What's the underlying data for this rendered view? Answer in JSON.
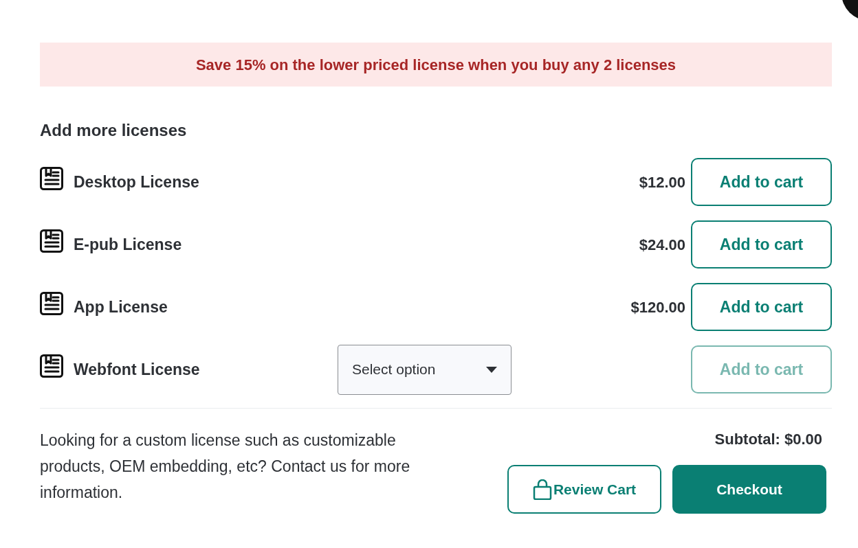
{
  "promo_banner": "Save 15% on the lower priced license when you buy any 2 licenses",
  "section_title": "Add more licenses",
  "licenses": [
    {
      "kind": "price",
      "name": "Desktop License",
      "price": "$12.00",
      "button": "Add to cart",
      "disabled": false
    },
    {
      "kind": "price",
      "name": "E-pub License",
      "price": "$24.00",
      "button": "Add to cart",
      "disabled": false
    },
    {
      "kind": "price",
      "name": "App License",
      "price": "$120.00",
      "button": "Add to cart",
      "disabled": false
    },
    {
      "kind": "select",
      "name": "Webfont License",
      "select": "Select option",
      "button": "Add to cart",
      "disabled": true
    }
  ],
  "custom_note": "Looking for a custom license such as customizable products, OEM embedding, etc? Contact us for more information.",
  "subtotal": "Subtotal: $0.00",
  "actions": [
    {
      "kind": "outline",
      "label": "Review Cart"
    },
    {
      "kind": "filled",
      "label": "Checkout"
    }
  ]
}
